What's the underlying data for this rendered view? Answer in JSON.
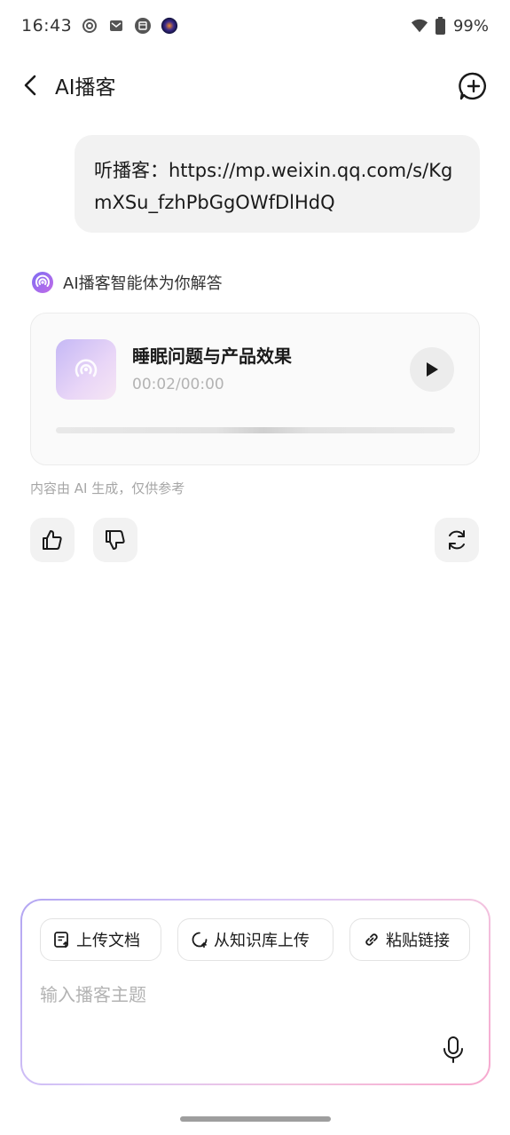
{
  "status_bar": {
    "time": "16:43",
    "battery": "99%",
    "icons": [
      "settings-ring-icon",
      "mail-icon",
      "calendar-icon",
      "app-circle-icon",
      "wifi-icon",
      "battery-icon"
    ]
  },
  "header": {
    "title": "AI播客",
    "back_icon": "chevron-left-icon",
    "new_chat_icon": "new-chat-plus-icon"
  },
  "user_message": {
    "text": "听播客：https://mp.weixin.qq.com/s/KgmXSu_fzhPbGgOWfDlHdQ"
  },
  "agent": {
    "label": "AI播客智能体为你解答",
    "icon": "podcast-signal-icon"
  },
  "audio_card": {
    "title": "睡眠问题与产品效果",
    "time": "00:02/00:00",
    "progress": 0.05,
    "play_icon": "play-icon"
  },
  "disclaimer": "内容由 AI 生成，仅供参考",
  "actions": {
    "like_icon": "thumbs-up-icon",
    "dislike_icon": "thumbs-down-icon",
    "regenerate_icon": "refresh-icon"
  },
  "input_panel": {
    "chips": [
      {
        "label": "上传文档",
        "icon": "document-upload-icon"
      },
      {
        "label": "从知识库上传",
        "icon": "knowledge-base-icon"
      },
      {
        "label": "粘贴链接",
        "icon": "link-icon"
      }
    ],
    "placeholder": "输入播客主题",
    "mic_icon": "microphone-icon"
  },
  "colors": {
    "accent_purple": "#9b7bf0",
    "accent_pink": "#f7a9cf",
    "bubble_bg": "#f2f2f2"
  }
}
